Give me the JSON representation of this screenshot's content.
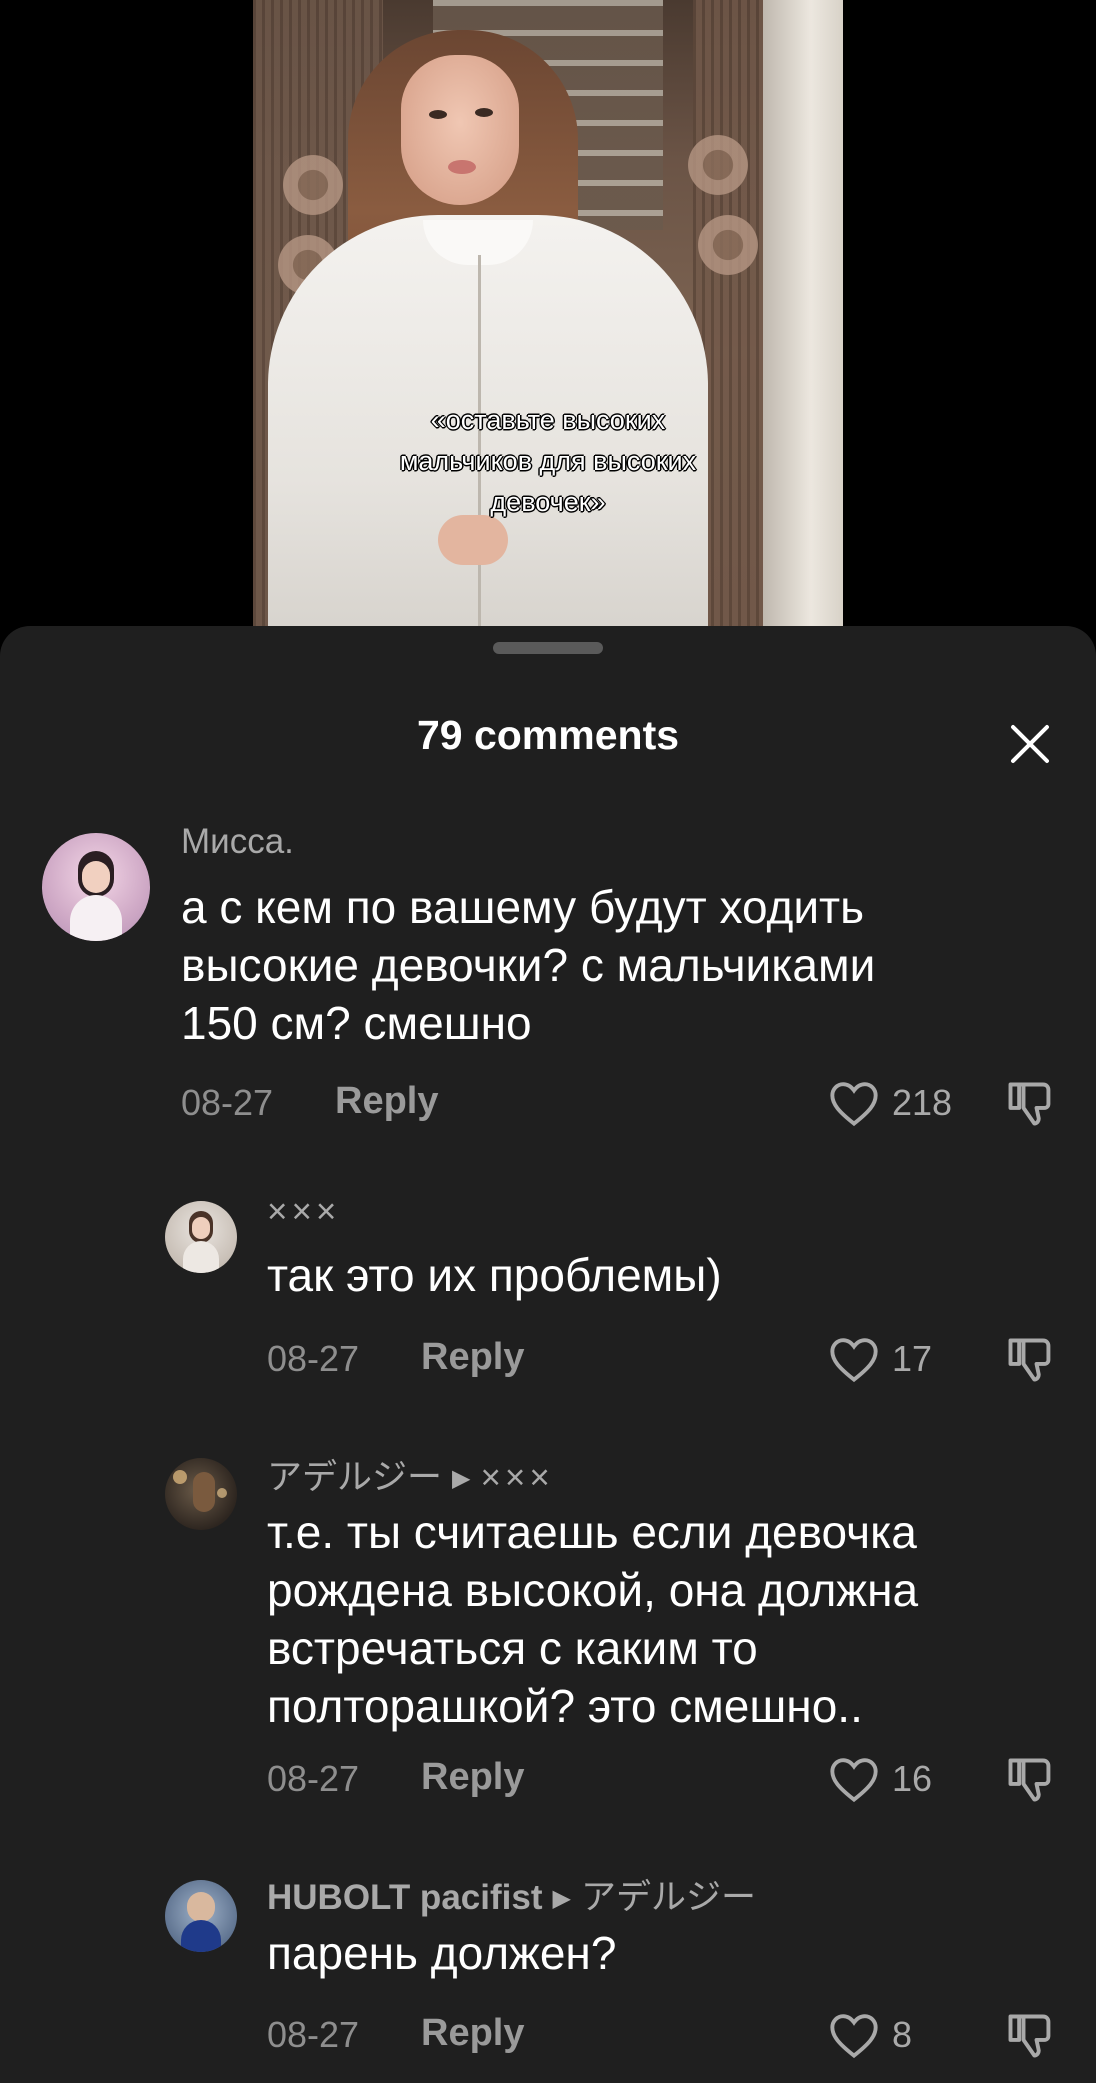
{
  "video": {
    "caption": "«оставьте высоких\nмальчиков для высоких\nдевочек»"
  },
  "comments_panel": {
    "title": "79 comments",
    "close_icon": "close-icon"
  },
  "comments": [
    {
      "username": "Мисса.",
      "reply_to": "",
      "text": "а с кем по вашему будут ходить\nвысокие девочки? с мальчиками\n150 см? смешно",
      "date": "08-27",
      "reply_label": "Reply",
      "likes": "218"
    },
    {
      "username": "×××",
      "reply_to": "",
      "text": "так это их проблемы)",
      "date": "08-27",
      "reply_label": "Reply",
      "likes": "17"
    },
    {
      "username": "アデルジー",
      "reply_to": "×××",
      "text": "т.е. ты считаешь если девочка\nрождена высокой, она должна\nвстречаться с каким то\nполторашкой? это смешно..",
      "date": "08-27",
      "reply_label": "Reply",
      "likes": "16"
    },
    {
      "username": "HUBOLT pacifist",
      "reply_to": "アデルジー",
      "text": "парень должен?",
      "date": "08-27",
      "reply_label": "Reply",
      "likes": "8"
    }
  ],
  "colors": {
    "sheet_bg": "#1f1f1f",
    "text": "#ffffff",
    "muted": "#a9a9a9"
  }
}
